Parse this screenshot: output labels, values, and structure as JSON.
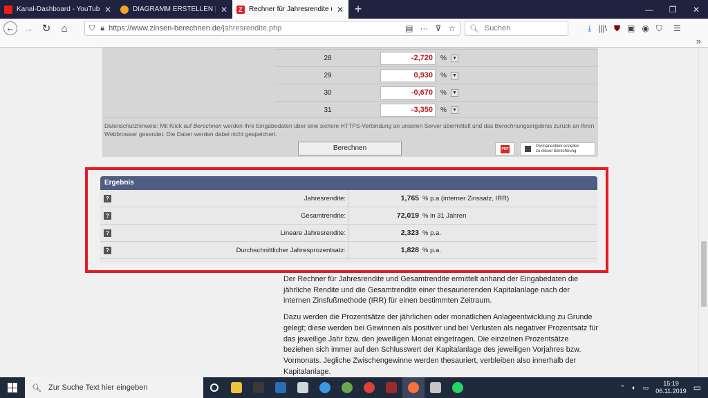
{
  "browser": {
    "tabs": [
      {
        "title": "Kanal-Dashboard - YouTube Stu",
        "favicon_color": "#e62117"
      },
      {
        "title": "DIAGRAMM ERSTELLEN | Erzeu",
        "favicon_color": "#f5a623"
      },
      {
        "title": "Rechner für Jahresrendite und G",
        "favicon_color": "#e51c23",
        "favicon_letter": "Z",
        "active": true
      }
    ],
    "newtab": "+",
    "url_host": "https://www.zinsen-berechnen.de",
    "url_path": "/jahresrendite.php",
    "search_placeholder": "Suchen"
  },
  "inputs": {
    "rows": [
      {
        "num": "28",
        "value": "-2,720"
      },
      {
        "num": "29",
        "value": "0,930"
      },
      {
        "num": "30",
        "value": "-0,670"
      },
      {
        "num": "31",
        "value": "-3,350"
      }
    ],
    "unit": "%",
    "privacy_label": "Datenschutzhinweis:",
    "privacy_pre": " Mit Klick auf ",
    "privacy_em": "Berechnen",
    "privacy_post": " werden Ihre Eingabedaten über eine sichere HTTPS-Verbindung an unseren Server übermittelt und das Berechnungsergebnis zurück an Ihren Webbrowser gesendet. Die Daten werden dabei nicht gespeichert.",
    "calc_button": "Berechnen",
    "pdf": "PDF",
    "permalink_line1": "Permanentlink erstellen",
    "permalink_line2": "zu dieser Berechnung"
  },
  "result": {
    "title": "Ergebnis",
    "help": "?",
    "rows": [
      {
        "label": "Jahresrendite:",
        "value": "1,765",
        "unit": "% p.a  (interner Zinssatz, IRR)"
      },
      {
        "label": "Gesamtrendite:",
        "value": "72,019",
        "unit": "% in 31 Jahren"
      },
      {
        "label": "Lineare Jahresrendite:",
        "value": "2,323",
        "unit": "% p.a."
      },
      {
        "label": "Durchschnittlicher Jahresprozentsatz:",
        "value": "1,828",
        "unit": "% p.a."
      }
    ]
  },
  "description": [
    "Der Rechner für Jahresrendite und Gesamtrendite ermittelt anhand der Eingabedaten die jährliche Rendite und die Gesamtrendite einer thesaurierenden Kapitalanlage nach der internen Zinsfußmethode (IRR) für einen bestimmten Zeitraum.",
    "Dazu werden die Prozentsätze der jährlichen oder monatlichen Anlageentwicklung zu Grunde gelegt; diese werden bei Gewinnen als positiver und bei Verlusten als negativer Prozentsatz für das jeweilige Jahr bzw. den jeweiligen Monat eingetragen. Die einzelnen Prozentsätze beziehen sich immer auf den Schlusswert der Kapitalanlage des jeweiligen Vorjahres bzw. Vormonats. Jegliche Zwischengewinne werden thesauriert, verbleiben also innerhalb der Kapitalanlage."
  ],
  "taskbar": {
    "search_placeholder": "Zur Suche Text hier eingeben",
    "time": "15:19",
    "date": "06.11.2019"
  }
}
